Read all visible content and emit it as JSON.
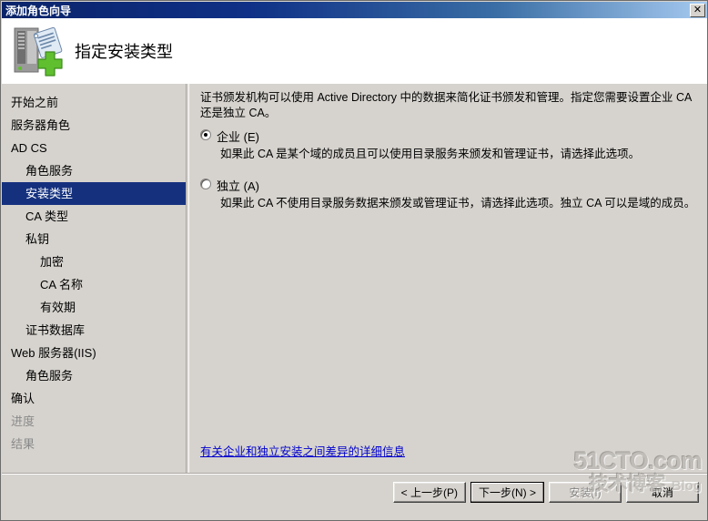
{
  "window": {
    "title": "添加角色向导",
    "close_label": "✕"
  },
  "header": {
    "title": "指定安装类型",
    "icon": "server-add-icon"
  },
  "sidebar": {
    "items": [
      {
        "label": "开始之前",
        "indent": 0,
        "selected": false,
        "disabled": false
      },
      {
        "label": "服务器角色",
        "indent": 0,
        "selected": false,
        "disabled": false
      },
      {
        "label": "AD CS",
        "indent": 0,
        "selected": false,
        "disabled": false
      },
      {
        "label": "角色服务",
        "indent": 1,
        "selected": false,
        "disabled": false
      },
      {
        "label": "安装类型",
        "indent": 1,
        "selected": true,
        "disabled": false
      },
      {
        "label": "CA 类型",
        "indent": 1,
        "selected": false,
        "disabled": false
      },
      {
        "label": "私钥",
        "indent": 1,
        "selected": false,
        "disabled": false
      },
      {
        "label": "加密",
        "indent": 2,
        "selected": false,
        "disabled": false
      },
      {
        "label": "CA 名称",
        "indent": 2,
        "selected": false,
        "disabled": false
      },
      {
        "label": "有效期",
        "indent": 2,
        "selected": false,
        "disabled": false
      },
      {
        "label": "证书数据库",
        "indent": 1,
        "selected": false,
        "disabled": false
      },
      {
        "label": "Web 服务器(IIS)",
        "indent": 0,
        "selected": false,
        "disabled": false
      },
      {
        "label": "角色服务",
        "indent": 1,
        "selected": false,
        "disabled": false
      },
      {
        "label": "确认",
        "indent": 0,
        "selected": false,
        "disabled": false
      },
      {
        "label": "进度",
        "indent": 0,
        "selected": false,
        "disabled": true
      },
      {
        "label": "结果",
        "indent": 0,
        "selected": false,
        "disabled": true
      }
    ]
  },
  "content": {
    "intro": "证书颁发机构可以使用 Active Directory 中的数据来简化证书颁发和管理。指定您需要设置企业 CA 还是独立 CA。",
    "options": [
      {
        "label": "企业 (E)",
        "description": "如果此 CA 是某个域的成员且可以使用目录服务来颁发和管理证书，请选择此选项。",
        "selected": true
      },
      {
        "label": "独立 (A)",
        "description": "如果此 CA 不使用目录服务数据来颁发或管理证书，请选择此选项。独立 CA 可以是域的成员。",
        "selected": false
      }
    ],
    "more_link": "有关企业和独立安装之间差异的详细信息"
  },
  "footer": {
    "buttons": [
      {
        "label": "< 上一步(P)",
        "default": false,
        "disabled": false
      },
      {
        "label": "下一步(N) >",
        "default": true,
        "disabled": false
      },
      {
        "label": "安装(I)",
        "default": false,
        "disabled": true
      },
      {
        "label": "取消",
        "default": false,
        "disabled": false
      }
    ]
  },
  "watermark": {
    "main": "51CTO.com",
    "sub": "技术博客",
    "blog": "Blog"
  }
}
